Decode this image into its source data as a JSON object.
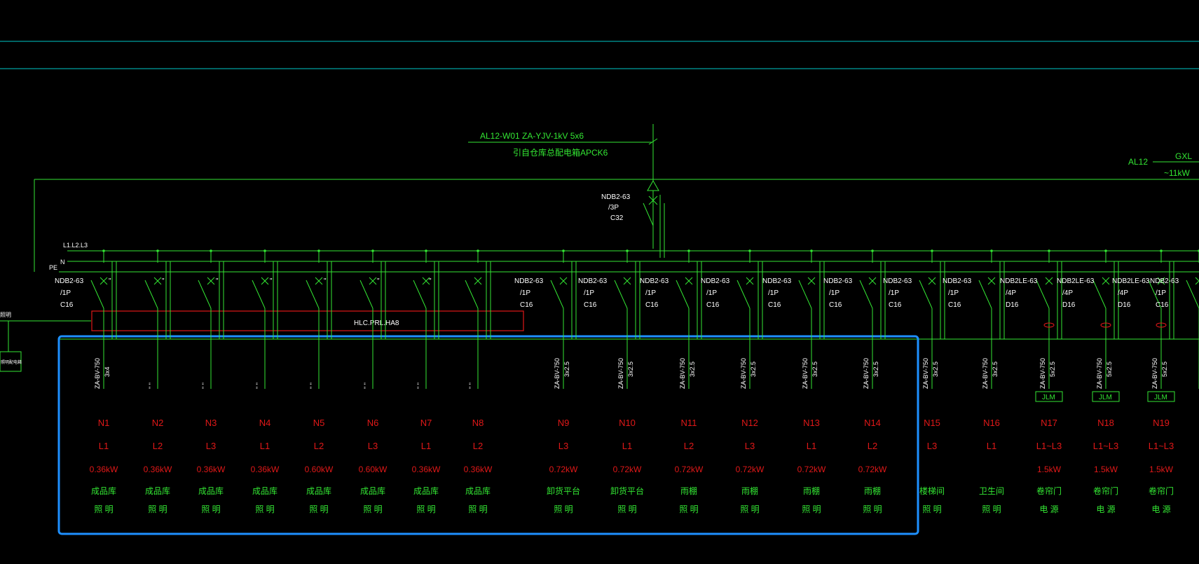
{
  "incoming": {
    "cable": "AL12-W01  ZA-YJV-1kV 5x6",
    "from": "引自仓库总配电箱APCK6"
  },
  "main_breaker": [
    "NDB2-63",
    "/3P",
    "C32"
  ],
  "right_panel": {
    "name": "AL12",
    "type": "GXL",
    "power": "~11kW"
  },
  "bus_labels": {
    "phases": "L1.L2.L3",
    "neutral": "N",
    "pe": "PE"
  },
  "left_stub_label": "照明",
  "left_box_label": "照明配电箱",
  "controller_label": "HLC.PRL.HA8",
  "circuits": [
    {
      "id": "N1",
      "phase": "L1",
      "power": "0.36kW",
      "name": "成品库",
      "use": "照 明",
      "breaker": [
        "NDB2-63",
        "/1P",
        "C16"
      ],
      "cable": [
        "ZA-BV-750",
        "3x4"
      ]
    },
    {
      "id": "N2",
      "phase": "L2",
      "power": "0.36kW",
      "name": "成品库",
      "use": "照 明",
      "breaker": [
        "\""
      ],
      "cable": [
        "\"  \""
      ]
    },
    {
      "id": "N3",
      "phase": "L3",
      "power": "0.36kW",
      "name": "成品库",
      "use": "照 明",
      "breaker": [
        "\""
      ],
      "cable": [
        "\"  \""
      ]
    },
    {
      "id": "N4",
      "phase": "L1",
      "power": "0.36kW",
      "name": "成品库",
      "use": "照 明",
      "breaker": [
        "\""
      ],
      "cable": [
        "\"  \""
      ]
    },
    {
      "id": "N5",
      "phase": "L2",
      "power": "0.60kW",
      "name": "成品库",
      "use": "照 明",
      "breaker": [
        "\""
      ],
      "cable": [
        "\"  \""
      ]
    },
    {
      "id": "N6",
      "phase": "L3",
      "power": "0.60kW",
      "name": "成品库",
      "use": "照 明",
      "breaker": [
        "\""
      ],
      "cable": [
        "\"  \""
      ]
    },
    {
      "id": "N7",
      "phase": "L1",
      "power": "0.36kW",
      "name": "成品库",
      "use": "照 明",
      "breaker": [
        "\""
      ],
      "cable": [
        "\"  \""
      ]
    },
    {
      "id": "N8",
      "phase": "L2",
      "power": "0.36kW",
      "name": "成品库",
      "use": "照 明",
      "breaker": [
        "\""
      ],
      "cable": [
        "\"  \""
      ]
    },
    {
      "id": "N9",
      "phase": "L3",
      "power": "0.72kW",
      "name": "卸货平台",
      "use": "照 明",
      "breaker": [
        "NDB2-63",
        "/1P",
        "C16"
      ],
      "cable": [
        "ZA-BV-750",
        "3x2.5"
      ]
    },
    {
      "id": "N10",
      "phase": "L1",
      "power": "0.72kW",
      "name": "卸货平台",
      "use": "照 明",
      "breaker": [
        "NDB2-63",
        "/1P",
        "C16"
      ],
      "cable": [
        "ZA-BV-750",
        "3x2.5"
      ]
    },
    {
      "id": "N11",
      "phase": "L2",
      "power": "0.72kW",
      "name": "雨棚",
      "use": "照 明",
      "breaker": [
        "NDB2-63",
        "/1P",
        "C16"
      ],
      "cable": [
        "ZA-BV-750",
        "3x2.5"
      ]
    },
    {
      "id": "N12",
      "phase": "L3",
      "power": "0.72kW",
      "name": "雨棚",
      "use": "照 明",
      "breaker": [
        "NDB2-63",
        "/1P",
        "C16"
      ],
      "cable": [
        "ZA-BV-750",
        "3x2.5"
      ]
    },
    {
      "id": "N13",
      "phase": "L1",
      "power": "0.72kW",
      "name": "雨棚",
      "use": "照 明",
      "breaker": [
        "NDB2-63",
        "/1P",
        "C16"
      ],
      "cable": [
        "ZA-BV-750",
        "3x2.5"
      ]
    },
    {
      "id": "N14",
      "phase": "L2",
      "power": "0.72kW",
      "name": "雨棚",
      "use": "照 明",
      "breaker": [
        "NDB2-63",
        "/1P",
        "C16"
      ],
      "cable": [
        "ZA-BV-750",
        "3x2.5"
      ]
    },
    {
      "id": "N15",
      "phase": "L3",
      "power": "",
      "name": "楼梯间",
      "use": "照 明",
      "breaker": [
        "NDB2-63",
        "/1P",
        "C16"
      ],
      "cable": [
        "ZA-BV-750",
        "3x2.5"
      ]
    },
    {
      "id": "N16",
      "phase": "L1",
      "power": "",
      "name": "卫生间",
      "use": "照 明",
      "breaker": [
        "NDB2-63",
        "/1P",
        "C16"
      ],
      "cable": [
        "ZA-BV-750",
        "3x2.5"
      ]
    },
    {
      "id": "N17",
      "phase": "L1~L3",
      "power": "1.5kW",
      "name": "卷帘门",
      "use": "电 源",
      "breaker": [
        "NDB2LE-63",
        "/4P",
        "D16"
      ],
      "cable": [
        "ZA-BV-750",
        "5x2.5"
      ],
      "box": "JLM"
    },
    {
      "id": "N18",
      "phase": "L1~L3",
      "power": "1.5kW",
      "name": "卷帘门",
      "use": "电 源",
      "breaker": [
        "NDB2LE-63",
        "/4P",
        "D16"
      ],
      "cable": [
        "ZA-BV-750",
        "5x2.5"
      ],
      "box": "JLM"
    },
    {
      "id": "N19",
      "phase": "L1~L3",
      "power": "1.5kW",
      "name": "卷帘门",
      "use": "电 源",
      "breaker": [
        "NDB2LE-63",
        "/4P",
        "D16"
      ],
      "cable": [
        "ZA-BV-750",
        "5x2.5"
      ],
      "box": "JLM"
    },
    {
      "id": "",
      "phase": "",
      "power": "",
      "name": "",
      "use": "",
      "breaker": [
        "NDB2-63",
        "/1P",
        "C16"
      ],
      "cable": []
    }
  ],
  "colors": {
    "background": "#000000",
    "line": "#33e633",
    "text": "#ffffff",
    "label": "#e01818",
    "guide": "#00c8c8",
    "selection": "#1e90ff"
  }
}
